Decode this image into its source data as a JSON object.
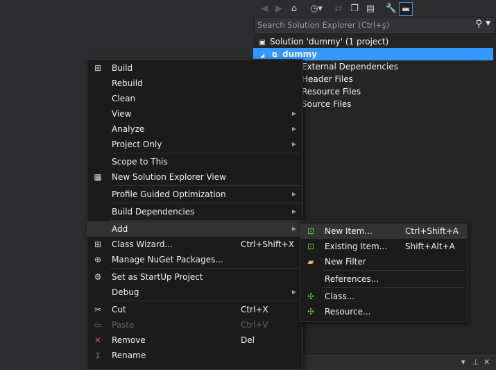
{
  "solution_explorer": {
    "search_placeholder": "Search Solution Explorer (Ctrl+ş)",
    "tree": {
      "solution": "Solution 'dummy' (1 project)",
      "project": "dummy",
      "folders": [
        "External Dependencies",
        "Header Files",
        "Resource Files",
        "Source Files"
      ]
    },
    "toolbar_icons": [
      "back-icon",
      "forward-icon",
      "home-icon",
      "history-icon",
      "sync-icon",
      "collapse-all-icon",
      "show-all-files-icon",
      "properties-icon",
      "preview-icon"
    ]
  },
  "context_menu": {
    "items": [
      {
        "label": "Build",
        "icon": "build-icon"
      },
      {
        "label": "Rebuild"
      },
      {
        "label": "Clean"
      },
      {
        "label": "View",
        "submenu": true
      },
      {
        "label": "Analyze",
        "submenu": true
      },
      {
        "label": "Project Only",
        "submenu": true
      },
      {
        "label": "Scope to This"
      },
      {
        "label": "New Solution Explorer View",
        "icon": "new-view-icon"
      },
      {
        "label": "Profile Guided Optimization",
        "submenu": true
      },
      {
        "label": "Build Dependencies",
        "submenu": true
      },
      {
        "label": "Add",
        "submenu": true,
        "highlighted": true
      },
      {
        "label": "Class Wizard...",
        "shortcut": "Ctrl+Shift+X",
        "icon": "class-wizard-icon"
      },
      {
        "label": "Manage NuGet Packages...",
        "icon": "nuget-icon"
      },
      {
        "label": "Set as StartUp Project",
        "icon": "gear-icon"
      },
      {
        "label": "Debug",
        "submenu": true
      },
      {
        "label": "Cut",
        "shortcut": "Ctrl+X",
        "icon": "scissors-icon"
      },
      {
        "label": "Paste",
        "shortcut": "Ctrl+V",
        "icon": "paste-icon",
        "disabled": true
      },
      {
        "label": "Remove",
        "shortcut": "Del",
        "icon": "remove-icon"
      },
      {
        "label": "Rename",
        "icon": "rename-icon"
      }
    ]
  },
  "add_submenu": {
    "items": [
      {
        "label": "New Item...",
        "shortcut": "Ctrl+Shift+A",
        "icon": "new-item-icon",
        "highlighted": true
      },
      {
        "label": "Existing Item...",
        "shortcut": "Shift+Alt+A",
        "icon": "existing-item-icon"
      },
      {
        "label": "New Filter",
        "icon": "folder-icon"
      },
      {
        "label": "References..."
      },
      {
        "label": "Class...",
        "icon": "class-icon"
      },
      {
        "label": "Resource...",
        "icon": "resource-icon"
      }
    ]
  },
  "colors": {
    "selection": "#3399ff",
    "menu_bg": "#1b1b1c",
    "highlight": "#333334",
    "panel_bg": "#252526"
  }
}
